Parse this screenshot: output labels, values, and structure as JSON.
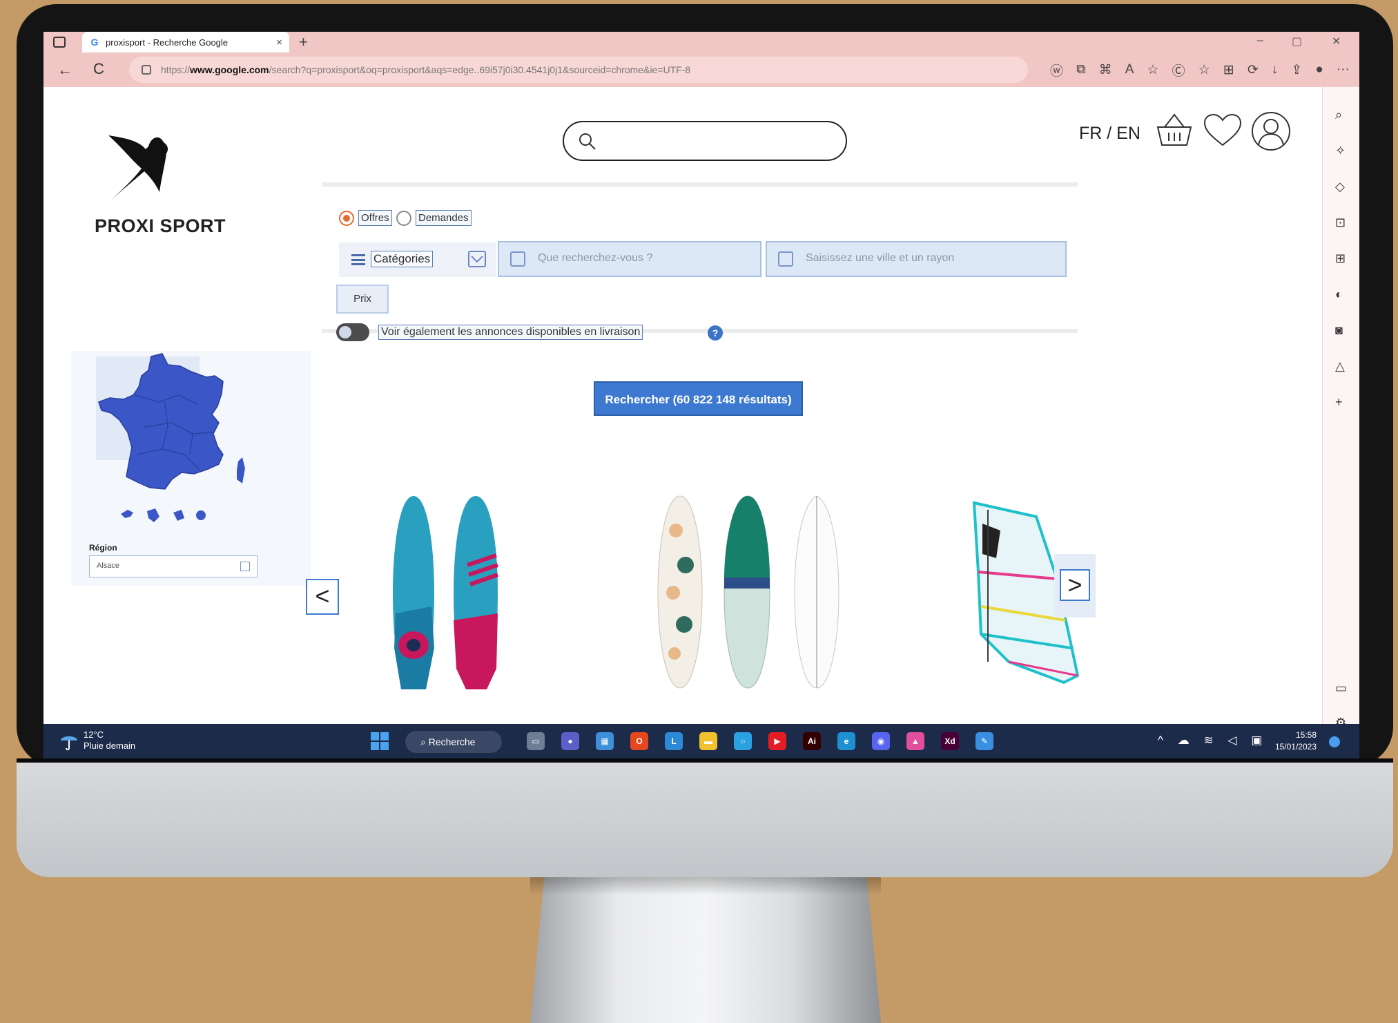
{
  "browser": {
    "tab_title": "proxisport - Recherche Google",
    "tab_close": "×",
    "new_tab": "+",
    "url_prefix": "https://",
    "url_domain": "www.google.com",
    "url_rest": "/search?q=proxisport&oq=proxisport&aqs=edge..69i57j0i30.4541j0j1&sourceid=chrome&ie=UTF-8",
    "window_controls": [
      "–",
      "▢",
      "✕"
    ],
    "nav": {
      "back": "←",
      "reload": "C"
    },
    "toolbar_icons": [
      "ⓦ",
      "⧉",
      "⌘",
      "A",
      "☆",
      "Ⓒ",
      "☆",
      "⊞",
      "⟳",
      "↓",
      "⇪",
      "●",
      "···"
    ]
  },
  "site": {
    "brand": "PROXI SPORT",
    "lang": "FR / EN",
    "filters": {
      "offers_label": "Offres",
      "requests_label": "Demandes",
      "categories_label": "Catégories",
      "query_placeholder": "Que recherchez-vous ?",
      "location_placeholder": "Saisissez une ville et un rayon",
      "price_label": "Prix",
      "delivery_label": "Voir également les annonces disponibles en livraison",
      "help_glyph": "?",
      "search_button": "Rechercher (60 822 148 résultats)"
    },
    "map": {
      "region_label": "Région",
      "region_value": "Alsace"
    },
    "carousel": {
      "prev": "<",
      "next": ">",
      "products": [
        "windsurf boards",
        "surfboards",
        "windsurf sail"
      ]
    }
  },
  "taskbar": {
    "temperature": "12°C",
    "weather": "Pluie demain",
    "search_label": "Recherche",
    "time": "15:58",
    "date": "15/01/2023",
    "tray_icons": "^ ☁ ≋ ◁ ▣",
    "apps": [
      {
        "name": "File",
        "glyph": "▭",
        "color": "#6d7e95"
      },
      {
        "name": "Chat",
        "glyph": "●",
        "color": "#5b5fc7"
      },
      {
        "name": "Store",
        "glyph": "▦",
        "color": "#3e8fd9"
      },
      {
        "name": "Office",
        "glyph": "O",
        "color": "#e8461c"
      },
      {
        "name": "L",
        "glyph": "L",
        "color": "#2b89d6"
      },
      {
        "name": "Explorer",
        "glyph": "▬",
        "color": "#f1c22e"
      },
      {
        "name": "Cortana",
        "glyph": "○",
        "color": "#2aa1e0"
      },
      {
        "name": "YouTube",
        "glyph": "▶",
        "color": "#e51c23"
      },
      {
        "name": "Illustrator",
        "glyph": "Ai",
        "color": "#330000"
      },
      {
        "name": "Edge",
        "glyph": "e",
        "color": "#1e8fd0"
      },
      {
        "name": "Discord",
        "glyph": "◉",
        "color": "#5865f2"
      },
      {
        "name": "Photos",
        "glyph": "▲",
        "color": "#e04e9c"
      },
      {
        "name": "XD",
        "glyph": "Xd",
        "color": "#470137"
      },
      {
        "name": "Snip",
        "glyph": "✎",
        "color": "#3a8fe0"
      }
    ]
  }
}
